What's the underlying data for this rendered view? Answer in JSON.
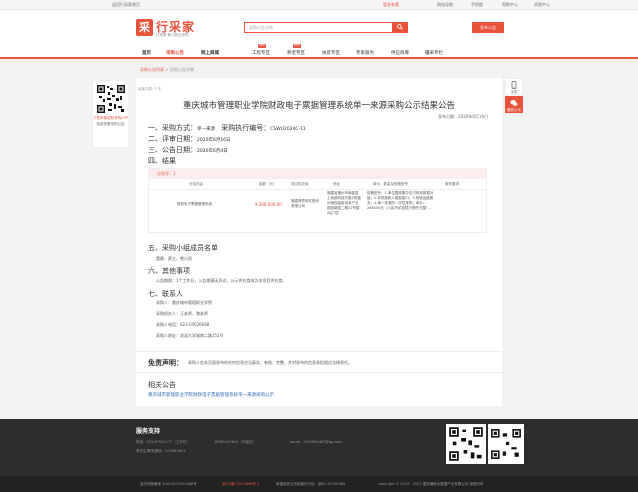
{
  "topbar": {
    "home": "返回行采家首页",
    "links": [
      "欢迎您",
      "注册",
      "登录有惠",
      "网站导航",
      "手机版",
      "帮助中心",
      "消息中心"
    ]
  },
  "header": {
    "logo_mark": "采",
    "logo_name": "行采家",
    "slogan": "行采家 助力政企采购",
    "search_placeholder": "采购公告名称",
    "publish_button": "发布公告"
  },
  "nav": {
    "items": [
      {
        "label": "首页",
        "badge": ""
      },
      {
        "label": "采购公告",
        "badge": ""
      },
      {
        "label": "网上商城",
        "badge": ""
      },
      {
        "label": "工程专区",
        "badge": "NEW"
      },
      {
        "label": "养老专区",
        "badge": "NEW"
      },
      {
        "label": "扶贫专区",
        "badge": ""
      },
      {
        "label": "专家服务",
        "badge": ""
      },
      {
        "label": "供应商库",
        "badge": ""
      },
      {
        "label": "疆采专栏",
        "badge": ""
      }
    ]
  },
  "breadcrumb": {
    "link": "采购公告列表",
    "sep": ">",
    "current": "采购公告详情"
  },
  "side_left": {
    "line1": "下载采家招标采购APP",
    "line2": "免费查看采购公告"
  },
  "side_right": {
    "items": [
      "手机",
      "微信公众号"
    ]
  },
  "article": {
    "views": "阅读次数: 7 次",
    "title": "重庆城市管理职业学院财政电子票据管理系统单一来源采购公示结果公告",
    "pubdate": "发布日期：2020年6月16日",
    "s1_label": "一、采购方式：",
    "s1_method": "单一来源",
    "s1_code_label": "采购执行编号：",
    "s1_code": "CSWU2020C-11",
    "s2_label": "二、评审日期：",
    "s2_value": "2020年6月16日",
    "s3_label": "三、公告日期：",
    "s3_value": "2020年6月4日",
    "s4_label": "四、结果",
    "table": {
      "package": "分包号：1",
      "headers": [
        "分包内容",
        "金额（元）",
        "成交供应商",
        "地址",
        "单价、数量及规格型号",
        "服务要求"
      ],
      "row": {
        "content": "财政电子票据管理系统",
        "amount": "¥ 268,000.00",
        "supplier": "福建博思软件股份有限公司",
        "address": "福建省福州市闽侯县上街镇科技东路3号福州海西高新技术产业园创新园二期22号楼A区7层",
        "spec": "规格型号：1.单位国库集中支付体系数据对接；2.非税缴款人缴费接口；3.系统运维服务；4.单一来源的一次性采购；单价：268000元（人民币贰拾陆万捌仟元整）。",
        "service": ""
      }
    },
    "s5_label": "五、采购小组成员名单",
    "s5_value": "董静，蔡立，熊小凯",
    "s6_label": "六、其他事项",
    "s6_value": "公告期限：1个工作日，公告期满无异议，公示供应商成为本项目供应商。",
    "s7_label": "七、联系人",
    "contacts": [
      "采购人：重庆城市管理职业学院",
      "采购经办人：汪老师，黎老师",
      "采购人电话：023-65626068",
      "采购人地址：虎溪大学城南二路151号"
    ],
    "stmt_label": "免责声明：",
    "stmt_text": "采购人在本页面发布的任何信息应当真实、有效、完整，并对发布的信息承担相应法律责任。"
  },
  "related": {
    "heading": "相关公告",
    "link": "重庆城市管理职业学院财政电子票据管理系统单一来源采购公示"
  },
  "footer": {
    "service": "服务支持",
    "phone": "电话：023-67922277（工作日）",
    "phone2": "18065167803（升级日）",
    "email": "email：1461694487@qq.com",
    "qq": "李先生/联系微信：023961601",
    "bottom": [
      "重庆网警备案 50019202000488号",
      "渝ICP备13003866号-2",
      "增值电信业务经营许可证：渝B1-20190989",
      "copyright © 2019 - 2023 重庆瀚雨大数据产业有限公司 版权所有"
    ]
  },
  "colors": {
    "brand": "#e8513a",
    "link": "#2f6fb6",
    "footer_bg": "#2d2d2d"
  }
}
